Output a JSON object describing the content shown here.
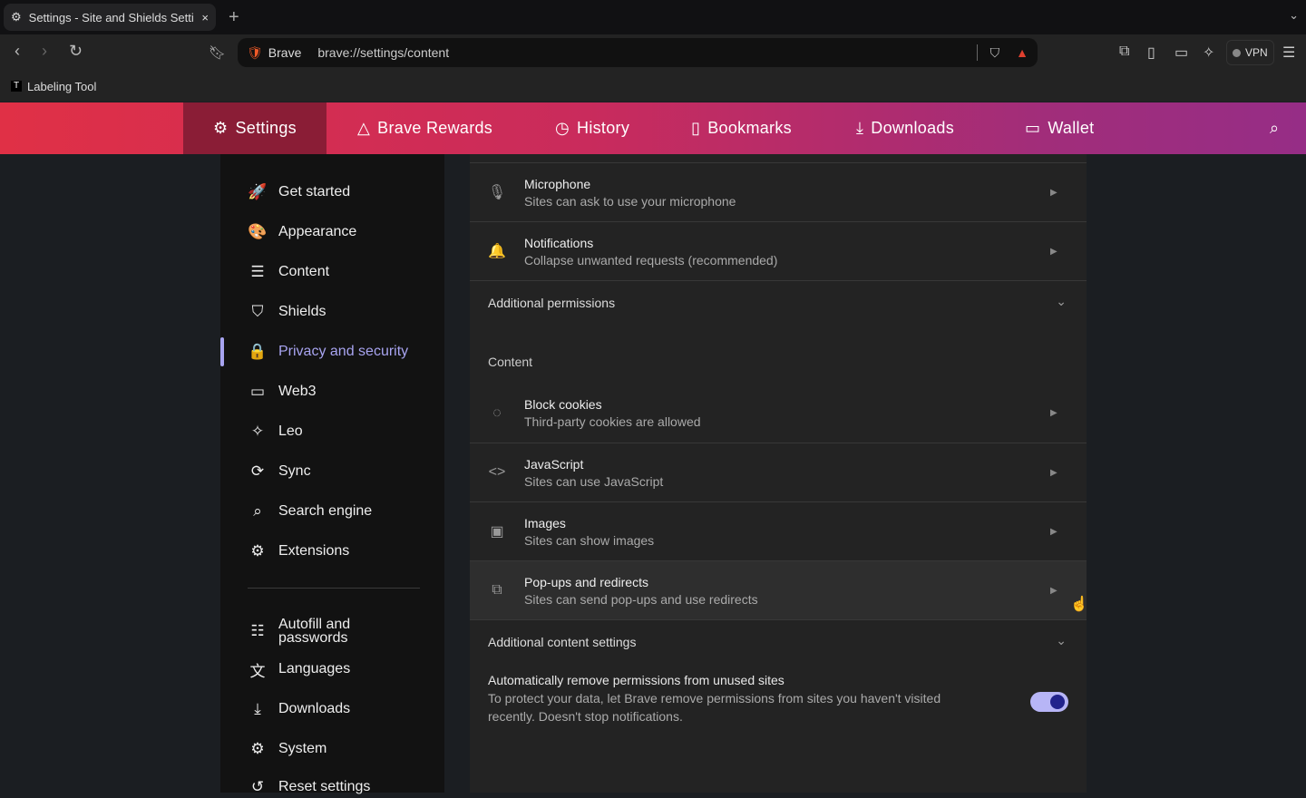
{
  "tab": {
    "title": "Settings - Site and Shields Settings",
    "new_tab": "+",
    "close": "×",
    "menu": "⌄"
  },
  "toolbar": {
    "brand": "Brave",
    "url": "brave://settings/content",
    "vpn": "VPN"
  },
  "bookmarks": [
    {
      "label": "Labeling Tool"
    }
  ],
  "header": {
    "items": [
      "Settings",
      "Brave Rewards",
      "History",
      "Bookmarks",
      "Downloads",
      "Wallet"
    ]
  },
  "sidebar": {
    "items": [
      {
        "label": "Get started",
        "icon": "🚀"
      },
      {
        "label": "Appearance",
        "icon": "🎨"
      },
      {
        "label": "Content",
        "icon": "☰"
      },
      {
        "label": "Shields",
        "icon": "⛉"
      },
      {
        "label": "Privacy and security",
        "icon": "🔒"
      },
      {
        "label": "Web3",
        "icon": "▭"
      },
      {
        "label": "Leo",
        "icon": "✧"
      },
      {
        "label": "Sync",
        "icon": "⟳"
      },
      {
        "label": "Search engine",
        "icon": "⌕"
      },
      {
        "label": "Extensions",
        "icon": "⚙"
      },
      {
        "label": "Autofill and passwords",
        "icon": "☷"
      },
      {
        "label": "Languages",
        "icon": "文"
      },
      {
        "label": "Downloads",
        "icon": "⤓"
      },
      {
        "label": "System",
        "icon": "⚙"
      },
      {
        "label": "Reset settings",
        "icon": "↺"
      }
    ],
    "selected": "Privacy and security"
  },
  "main": {
    "permissions": [
      {
        "title": "Microphone",
        "desc": "Sites can ask to use your microphone",
        "icon": "🎙"
      },
      {
        "title": "Notifications",
        "desc": "Collapse unwanted requests (recommended)",
        "icon": "🔔"
      }
    ],
    "additional_permissions": "Additional permissions",
    "content_heading": "Content",
    "content": [
      {
        "title": "Block cookies",
        "desc": "Third-party cookies are allowed",
        "icon": "◌"
      },
      {
        "title": "JavaScript",
        "desc": "Sites can use JavaScript",
        "icon": "<>"
      },
      {
        "title": "Images",
        "desc": "Sites can show images",
        "icon": "▣"
      },
      {
        "title": "Pop-ups and redirects",
        "desc": "Sites can send pop-ups and use redirects",
        "icon": "⧉"
      }
    ],
    "additional_content": "Additional content settings",
    "auto_remove": {
      "title": "Automatically remove permissions from unused sites",
      "desc": "To protect your data, let Brave remove permissions from sites you haven't visited recently. Doesn't stop notifications.",
      "enabled": true
    }
  }
}
